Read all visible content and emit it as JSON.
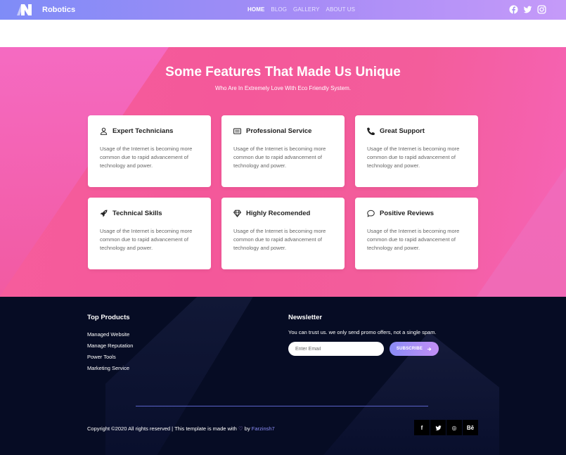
{
  "header": {
    "brand": "Robotics",
    "nav": [
      {
        "label": "HOME",
        "active": true
      },
      {
        "label": "BLOG",
        "active": false
      },
      {
        "label": "GALLERY",
        "active": false
      },
      {
        "label": "ABOUT US",
        "active": false
      }
    ],
    "social_icons": [
      "facebook-icon",
      "twitter-icon",
      "instagram-icon"
    ]
  },
  "features": {
    "title": "Some Features That Made Us Unique",
    "subtitle": "Who Are In Extremely Love With Eco Friendly System.",
    "cards": [
      {
        "icon": "user-icon",
        "title": "Expert Technicians",
        "text": "Usage of the Internet is becoming more common due to rapid advancement of technology and power."
      },
      {
        "icon": "license-icon",
        "title": "Professional Service",
        "text": "Usage of the Internet is becoming more common due to rapid advancement of technology and power."
      },
      {
        "icon": "phone-icon",
        "title": "Great Support",
        "text": "Usage of the Internet is becoming more common due to rapid advancement of technology and power."
      },
      {
        "icon": "rocket-icon",
        "title": "Technical Skills",
        "text": "Usage of the Internet is becoming more common due to rapid advancement of technology and power."
      },
      {
        "icon": "diamond-icon",
        "title": "Highly Recomended",
        "text": "Usage of the Internet is becoming more common due to rapid advancement of technology and power."
      },
      {
        "icon": "chat-bubble-icon",
        "title": "Positive Reviews",
        "text": "Usage of the Internet is becoming more common due to rapid advancement of technology and power."
      }
    ]
  },
  "footer": {
    "top_products_title": "Top Products",
    "top_products": [
      "Managed Website",
      "Manage Reputation",
      "Power Tools",
      "Marketing Service"
    ],
    "newsletter_title": "Newsletter",
    "newsletter_text": "You can trust us. we only send promo offers, not a single spam.",
    "email_placeholder": "Enter Email",
    "subscribe_label": "SUBSCRIBE",
    "copyright_prefix": "Copyright ©2020 All rights reserved | This template is made with",
    "copyright_by": "by",
    "copyright_author": "Farzinsh7",
    "social": [
      {
        "icon": "facebook-icon",
        "glyph": "f"
      },
      {
        "icon": "twitter-icon",
        "glyph": "t"
      },
      {
        "icon": "dribbble-icon",
        "glyph": "◎"
      },
      {
        "icon": "behance-icon",
        "glyph": "Bē"
      }
    ]
  },
  "colors": {
    "header_gradient_start": "#7f8cf7",
    "header_gradient_end": "#c59af9",
    "features_pink": "#f4589a",
    "footer_bg": "#060c24",
    "accent": "#8a8cf6"
  }
}
